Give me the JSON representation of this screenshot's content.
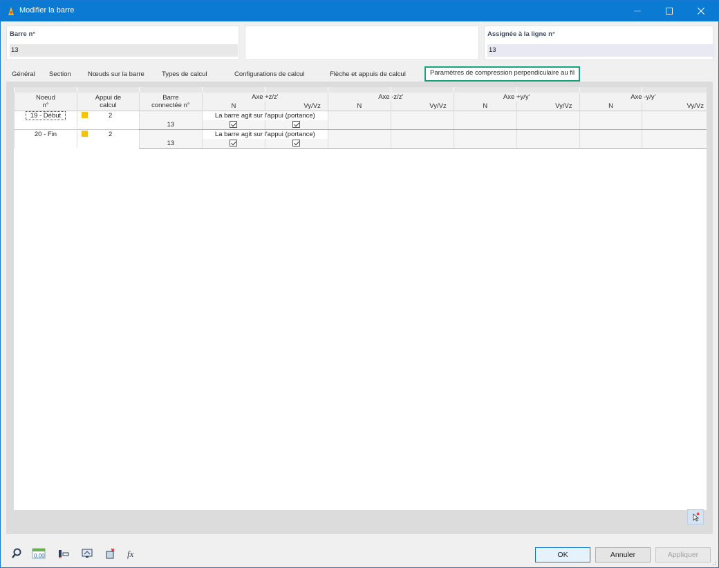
{
  "window": {
    "title": "Modifier la barre"
  },
  "header": {
    "member_label": "Barre n°",
    "member_value": "13",
    "assigned_label": "Assignée à la ligne n°",
    "assigned_value": "13"
  },
  "tabs": [
    {
      "label": "Général"
    },
    {
      "label": "Section"
    },
    {
      "label": "Nœuds sur la barre"
    },
    {
      "label": "Types de calcul"
    },
    {
      "label": "Configurations de calcul"
    },
    {
      "label": "Flèche et appuis de calcul"
    },
    {
      "label": "Paramètres de compression perpendiculaire au fil"
    }
  ],
  "grid": {
    "headers": {
      "node": "Noeud",
      "node_sub": "n°",
      "support": "Appui de",
      "support_sub": "calcul",
      "conn": "Barre",
      "conn_sub": "connectée n°",
      "axis_pz": "Axe +z/z'",
      "axis_mz": "Axe -z/z'",
      "axis_py": "Axe +y/y'",
      "axis_my": "Axe -y/y'",
      "n": "N",
      "vyvz": "Vy/Vz"
    },
    "rows": [
      {
        "node": "19 - Début",
        "support": "2",
        "note": "La barre agit sur l'appui (portance)",
        "connected": "13",
        "n_checked": true,
        "v_checked": true
      },
      {
        "node": "20 - Fin",
        "support": "2",
        "note": "La barre agit sur l'appui (portance)",
        "connected": "13",
        "n_checked": true,
        "v_checked": true
      }
    ],
    "support_color": "#f5c211"
  },
  "buttons": {
    "ok": "OK",
    "cancel": "Annuler",
    "apply": "Appliquer"
  },
  "colors": {
    "titlebar": "#0a7ad2",
    "active_tab_border": "#14a37a"
  },
  "toolbar_icons": [
    "search-icon",
    "numeric-format-icon",
    "member-view-icon",
    "display-icon",
    "section-icon",
    "formula-icon"
  ]
}
